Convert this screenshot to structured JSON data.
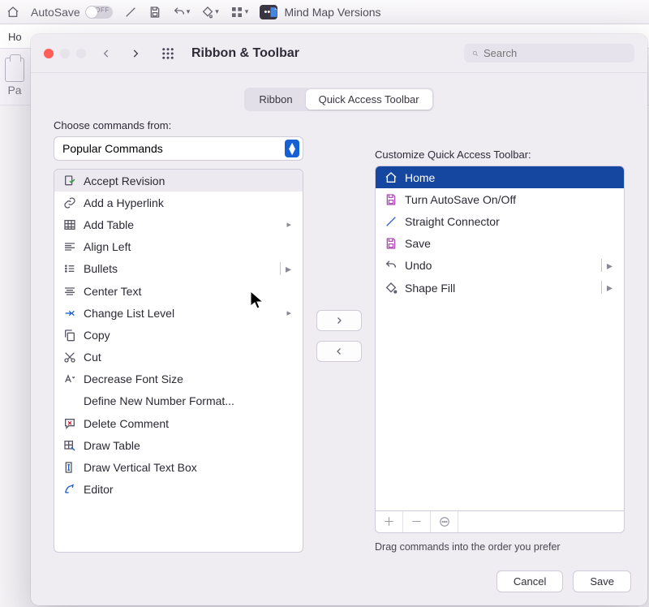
{
  "app": {
    "autosave_label": "AutoSave",
    "autosave_off": "OFF",
    "document_title": "Mind Map Versions",
    "home_tab": "Ho",
    "paste_label": "Pa"
  },
  "dialog": {
    "title": "Ribbon & Toolbar",
    "search_placeholder": "Search",
    "tabs": {
      "ribbon": "Ribbon",
      "qat": "Quick Access Toolbar",
      "active": "qat"
    }
  },
  "left": {
    "choose_label": "Choose commands from:",
    "source": "Popular Commands",
    "commands": [
      {
        "label": "Accept Revision",
        "icon": "accept",
        "selected": true
      },
      {
        "label": "Add a Hyperlink",
        "icon": "link"
      },
      {
        "label": "Add Table",
        "icon": "table",
        "submenu": true
      },
      {
        "label": "Align Left",
        "icon": "align-left"
      },
      {
        "label": "Bullets",
        "icon": "bullets",
        "submenu": true,
        "split": true
      },
      {
        "label": "Center Text",
        "icon": "align-center"
      },
      {
        "label": "Change List Level",
        "icon": "list-level",
        "submenu": true
      },
      {
        "label": "Copy",
        "icon": "copy"
      },
      {
        "label": "Cut",
        "icon": "cut"
      },
      {
        "label": "Decrease Font Size",
        "icon": "font-dec"
      },
      {
        "label": "Define New Number Format...",
        "icon": ""
      },
      {
        "label": "Delete Comment",
        "icon": "del-comment"
      },
      {
        "label": "Draw Table",
        "icon": "draw-table"
      },
      {
        "label": "Draw Vertical Text Box",
        "icon": "vtext"
      },
      {
        "label": "Editor",
        "icon": "editor"
      }
    ]
  },
  "right": {
    "customize_label": "Customize Quick Access Toolbar:",
    "items": [
      {
        "label": "Home",
        "icon": "home",
        "selected": true
      },
      {
        "label": "Turn AutoSave On/Off",
        "icon": "autosave"
      },
      {
        "label": "Straight Connector",
        "icon": "line"
      },
      {
        "label": "Save",
        "icon": "save"
      },
      {
        "label": "Undo",
        "icon": "undo",
        "split": true
      },
      {
        "label": "Shape Fill",
        "icon": "fill",
        "split": true
      }
    ],
    "hint": "Drag commands into the order you prefer"
  },
  "footer": {
    "cancel": "Cancel",
    "save": "Save"
  }
}
